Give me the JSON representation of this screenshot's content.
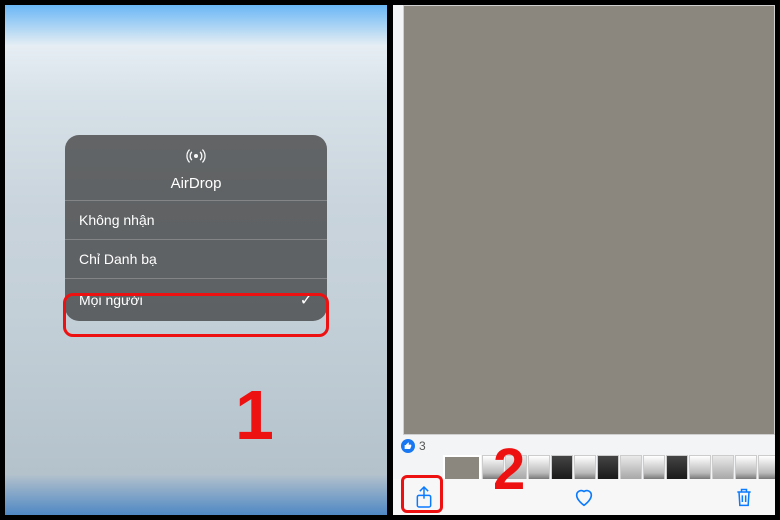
{
  "left": {
    "airdrop": {
      "title": "AirDrop",
      "options": {
        "off": "Không nhận",
        "contacts": "Chỉ Danh bạ",
        "everyone": "Mọi người"
      },
      "checkmark": "✓"
    },
    "step_number": "1"
  },
  "right": {
    "like_count": "3",
    "step_number": "2"
  },
  "colors": {
    "highlight": "#e11",
    "ios_blue": "#0a7aff"
  }
}
